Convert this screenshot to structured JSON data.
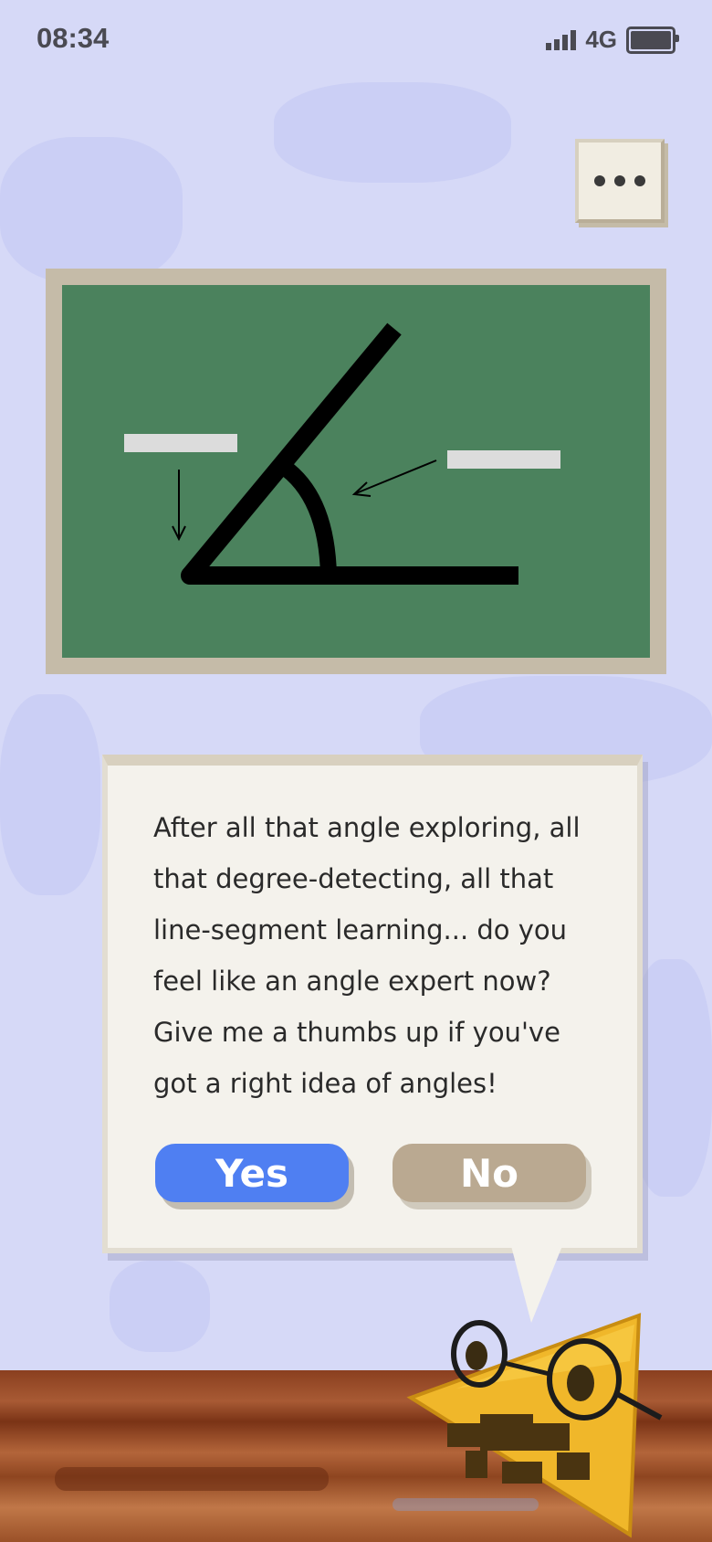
{
  "status_bar": {
    "time": "08:34",
    "network": "4G"
  },
  "menu": {
    "icon": "more-dots-icon"
  },
  "chalkboard": {
    "icon": "angle-diagram"
  },
  "dialog": {
    "message": "After all that angle exploring, all that degree-detecting, all that line-segment learning... do you feel like an angle expert now? Give me a thumbs up if you've got a right idea of angles!",
    "yes_label": "Yes",
    "no_label": "No"
  },
  "mascot": {
    "icon": "triangle-professor-mascot"
  },
  "colors": {
    "background": "#d6d9f7",
    "chalkboard": "#4b825d",
    "yes_button": "#4f7ff2",
    "no_button": "#baa991",
    "mascot": "#f0b72a"
  }
}
